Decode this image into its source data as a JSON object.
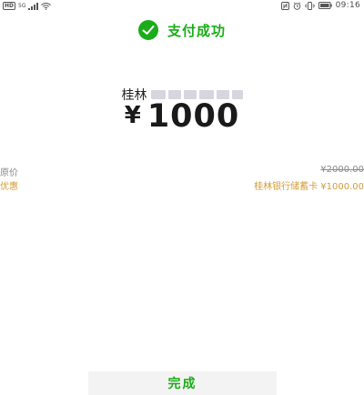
{
  "status_bar": {
    "hd_label": "HD",
    "network_label": "5G",
    "time": "09:16"
  },
  "header": {
    "title": "支付成功",
    "accent_color": "#1aad19"
  },
  "payment": {
    "payee_name": "桂林",
    "currency_symbol": "¥",
    "amount": "1000"
  },
  "details": {
    "original_price_label": "原价",
    "original_price_value": "¥2000.00",
    "discount_label": "优惠",
    "discount_value": "桂林银行储蓄卡 ¥1000.00",
    "discount_color": "#d59c37"
  },
  "actions": {
    "done_label": "完成"
  }
}
